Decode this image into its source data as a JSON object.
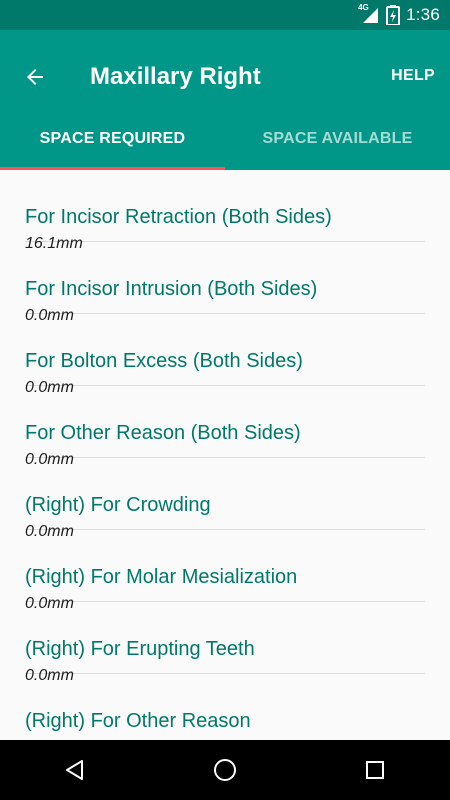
{
  "status_bar": {
    "network": "4G",
    "time": "1:36"
  },
  "toolbar": {
    "title": "Maxillary Right",
    "help_label": "HELP",
    "back_icon": "arrow-left-icon"
  },
  "tabs": [
    {
      "label": "SPACE REQUIRED",
      "selected": true
    },
    {
      "label": "SPACE AVAILABLE",
      "selected": false
    }
  ],
  "colors": {
    "app_bar": "#009688",
    "status_bar": "#00796b",
    "tab_indicator": "#ff5252",
    "item_label": "#00796b"
  },
  "items": [
    {
      "label": "For Incisor Retraction (Both Sides)",
      "value": "16.1mm"
    },
    {
      "label": "For Incisor Intrusion (Both Sides)",
      "value": "0.0mm"
    },
    {
      "label": "For Bolton Excess (Both Sides)",
      "value": "0.0mm"
    },
    {
      "label": "For Other Reason (Both Sides)",
      "value": "0.0mm"
    },
    {
      "label": "(Right) For Crowding",
      "value": "0.0mm"
    },
    {
      "label": "(Right) For Molar Mesialization",
      "value": "0.0mm"
    },
    {
      "label": "(Right) For Erupting Teeth",
      "value": "0.0mm"
    },
    {
      "label": "(Right) For Other Reason",
      "value": ""
    }
  ],
  "nav": {
    "back_icon": "triangle-back-icon",
    "home_icon": "circle-home-icon",
    "recents_icon": "square-recents-icon"
  }
}
